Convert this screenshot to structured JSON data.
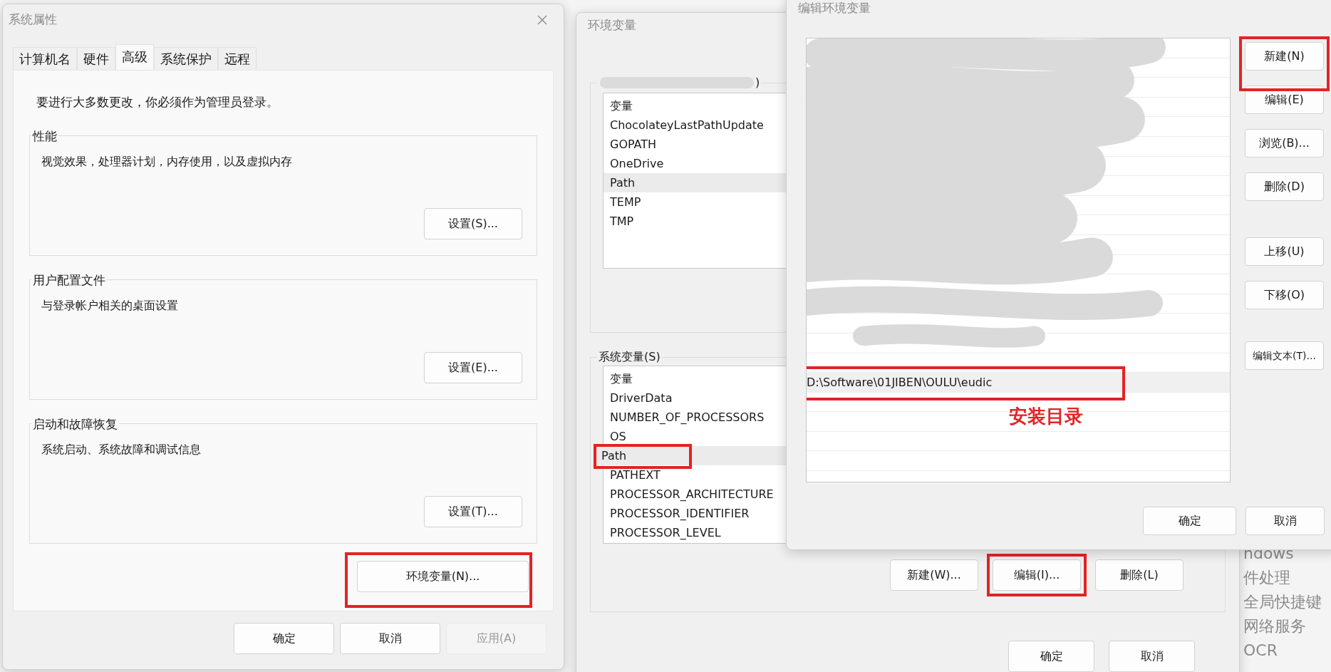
{
  "system_properties": {
    "title": "系统属性",
    "tabs": [
      {
        "label": "计算机名",
        "selected": false
      },
      {
        "label": "硬件",
        "selected": false
      },
      {
        "label": "高级",
        "selected": true
      },
      {
        "label": "系统保护",
        "selected": false
      },
      {
        "label": "远程",
        "selected": false
      }
    ],
    "notice": "要进行大多数更改，你必须作为管理员登录。",
    "groups": [
      {
        "title": "性能",
        "description": "视觉效果，处理器计划，内存使用，以及虚拟内存",
        "button": "设置(S)..."
      },
      {
        "title": "用户配置文件",
        "description": "与登录帐户相关的桌面设置",
        "button": "设置(E)..."
      },
      {
        "title": "启动和故障恢复",
        "description": "系统启动、系统故障和调试信息",
        "button": "设置(T)..."
      }
    ],
    "env_button": {
      "label": "环境变量(N)...",
      "highlighted": true
    },
    "footer_buttons": [
      {
        "label": "确定",
        "disabled": false
      },
      {
        "label": "取消",
        "disabled": false
      },
      {
        "label": "应用(A)",
        "disabled": true
      }
    ]
  },
  "environment_variables": {
    "title": "环境变量",
    "user_variables": {
      "title": ")",
      "header": "变量",
      "rows": [
        {
          "name": "ChocolateyLastPathUpdate",
          "selected": false,
          "highlighted": false
        },
        {
          "name": "GOPATH",
          "selected": false,
          "highlighted": false
        },
        {
          "name": "OneDrive",
          "selected": false,
          "highlighted": false
        },
        {
          "name": "Path",
          "selected": true,
          "highlighted": false
        },
        {
          "name": "TEMP",
          "selected": false,
          "highlighted": false
        },
        {
          "name": "TMP",
          "selected": false,
          "highlighted": false
        }
      ]
    },
    "system_variables": {
      "title": "系统变量(S)",
      "header": "变量",
      "rows": [
        {
          "name": "DriverData",
          "selected": false,
          "highlighted": false
        },
        {
          "name": "NUMBER_OF_PROCESSORS",
          "selected": false,
          "highlighted": false
        },
        {
          "name": "OS",
          "selected": false,
          "highlighted": false
        },
        {
          "name": "Path",
          "selected": true,
          "highlighted": true
        },
        {
          "name": "PATHEXT",
          "selected": false,
          "highlighted": false
        },
        {
          "name": "PROCESSOR_ARCHITECTURE",
          "selected": false,
          "highlighted": false
        },
        {
          "name": "PROCESSOR_IDENTIFIER",
          "selected": false,
          "highlighted": false
        },
        {
          "name": "PROCESSOR_LEVEL",
          "selected": false,
          "highlighted": false
        }
      ]
    },
    "system_buttons": [
      {
        "label": "新建(W)...",
        "highlighted": false
      },
      {
        "label": "编辑(I)...",
        "highlighted": true
      },
      {
        "label": "删除(L)",
        "highlighted": false
      }
    ],
    "footer_buttons": [
      "确定",
      "取消"
    ]
  },
  "edit_environment_variable": {
    "title": "编辑环境变量",
    "entries": [
      {
        "kind": "redacted",
        "selected": false
      },
      {
        "kind": "redacted",
        "selected": false
      },
      {
        "kind": "redacted",
        "selected": false
      },
      {
        "kind": "redacted",
        "selected": false
      },
      {
        "kind": "redacted",
        "selected": false
      },
      {
        "kind": "redacted",
        "selected": false
      },
      {
        "kind": "redacted",
        "selected": false
      },
      {
        "kind": "redacted",
        "selected": false
      },
      {
        "kind": "redacted",
        "selected": false
      },
      {
        "kind": "redacted",
        "selected": false
      },
      {
        "kind": "redacted",
        "selected": false
      },
      {
        "kind": "redacted",
        "selected": false
      },
      {
        "kind": "redacted",
        "selected": false
      },
      {
        "kind": "redacted",
        "selected": false
      },
      {
        "kind": "redacted",
        "selected": false
      },
      {
        "kind": "redacted",
        "selected": false
      },
      {
        "kind": "redacted",
        "selected": false
      },
      {
        "kind": "path",
        "text": "D:\\Software\\01JIBEN\\OULU\\eudic",
        "selected": true,
        "highlighted": true
      }
    ],
    "annotation": "安装目录",
    "side_buttons_top": [
      {
        "label": "新建(N)",
        "highlighted": true
      },
      {
        "label": "编辑(E)",
        "highlighted": false
      },
      {
        "label": "浏览(B)...",
        "highlighted": false
      },
      {
        "label": "删除(D)",
        "highlighted": false
      }
    ],
    "side_buttons_move": [
      {
        "label": "上移(U)",
        "highlighted": false
      },
      {
        "label": "下移(O)",
        "highlighted": false
      }
    ],
    "edit_text_button": "编辑文本(T)...",
    "footer_buttons": [
      "确定",
      "取消"
    ]
  },
  "background_menu": [
    "ndows",
    "件处理",
    "全局快捷键",
    "网络服务",
    "OCR"
  ]
}
